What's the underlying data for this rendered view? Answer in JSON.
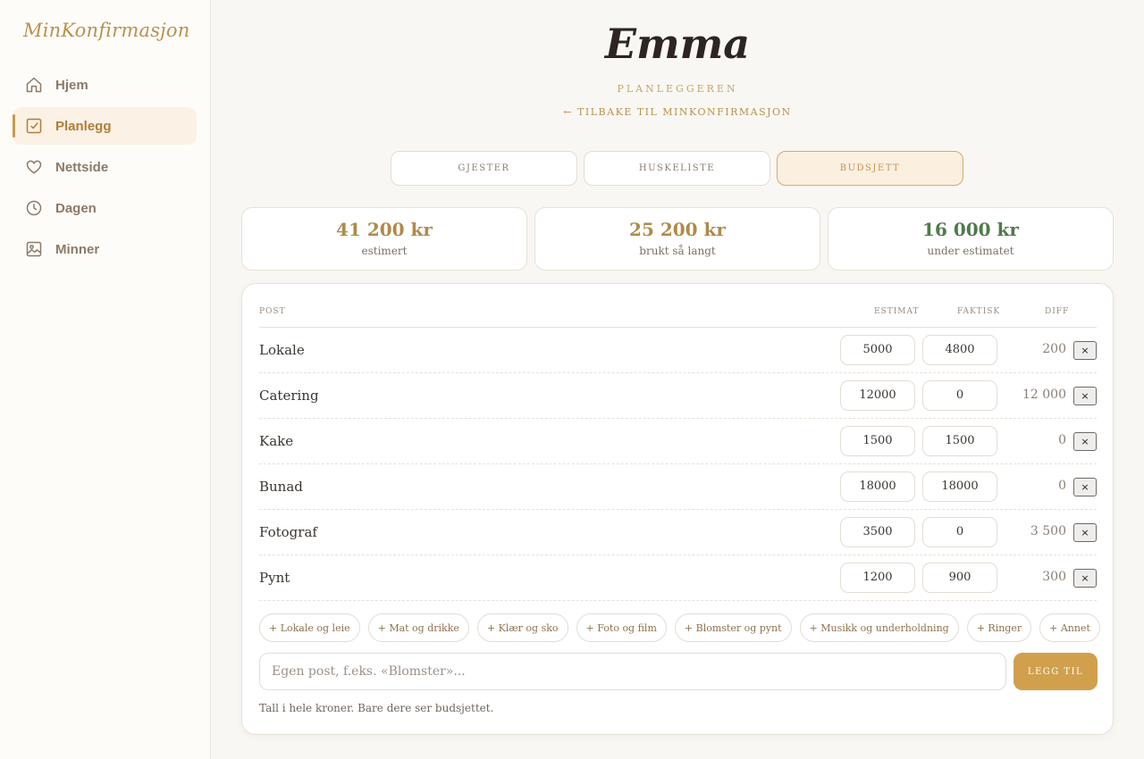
{
  "sidebar": {
    "logo": "MinKonfirmasjon",
    "items": [
      {
        "label": "Hjem",
        "icon": "home-icon"
      },
      {
        "label": "Planlegg",
        "icon": "checkbox-icon",
        "active": true
      },
      {
        "label": "Nettside",
        "icon": "heart-icon"
      },
      {
        "label": "Dagen",
        "icon": "clock-icon"
      },
      {
        "label": "Minner",
        "icon": "image-icon"
      }
    ]
  },
  "header": {
    "title": "Emma",
    "subtitle": "PLANLEGGEREN",
    "back_link": "← TILBAKE TIL MINKONFIRMASJON"
  },
  "tabs": [
    {
      "label": "GJESTER"
    },
    {
      "label": "HUSKELISTE"
    },
    {
      "label": "BUDSJETT",
      "active": true
    }
  ],
  "stats": [
    {
      "value": "41 200 kr",
      "label": "estimert"
    },
    {
      "value": "25 200 kr",
      "label": "brukt så langt"
    },
    {
      "value": "16 000 kr",
      "label": "under estimatet"
    }
  ],
  "table": {
    "columns": {
      "post": "POST",
      "estimate": "ESTIMAT",
      "actual": "FAKTISK",
      "diff": "DIFF"
    },
    "rows": [
      {
        "name": "Lokale",
        "estimate": "5000",
        "actual": "4800",
        "diff": "200"
      },
      {
        "name": "Catering",
        "estimate": "12000",
        "actual": "0",
        "diff": "12 000"
      },
      {
        "name": "Kake",
        "estimate": "1500",
        "actual": "1500",
        "diff": "0"
      },
      {
        "name": "Bunad",
        "estimate": "18000",
        "actual": "18000",
        "diff": "0"
      },
      {
        "name": "Fotograf",
        "estimate": "3500",
        "actual": "0",
        "diff": "3 500"
      },
      {
        "name": "Pynt",
        "estimate": "1200",
        "actual": "900",
        "diff": "300"
      }
    ],
    "delete_label": "×"
  },
  "chips": [
    "+ Lokale og leie",
    "+ Mat og drikke",
    "+ Klær og sko",
    "+ Foto og film",
    "+ Blomster og pynt",
    "+ Musikk og underholdning",
    "+ Ringer",
    "+ Annet"
  ],
  "add_form": {
    "placeholder": "Egen post, f.eks. «Blomster»...",
    "button": "LEGG TIL"
  },
  "footnote": "Tall i hele kroner. Bare dere ser budsjettet.",
  "colors": {
    "accent": "#c99a4b",
    "active_tab_bg": "#fbefe0",
    "positive_green": "#4f7a4a",
    "button_gold": "#d0a04d"
  }
}
